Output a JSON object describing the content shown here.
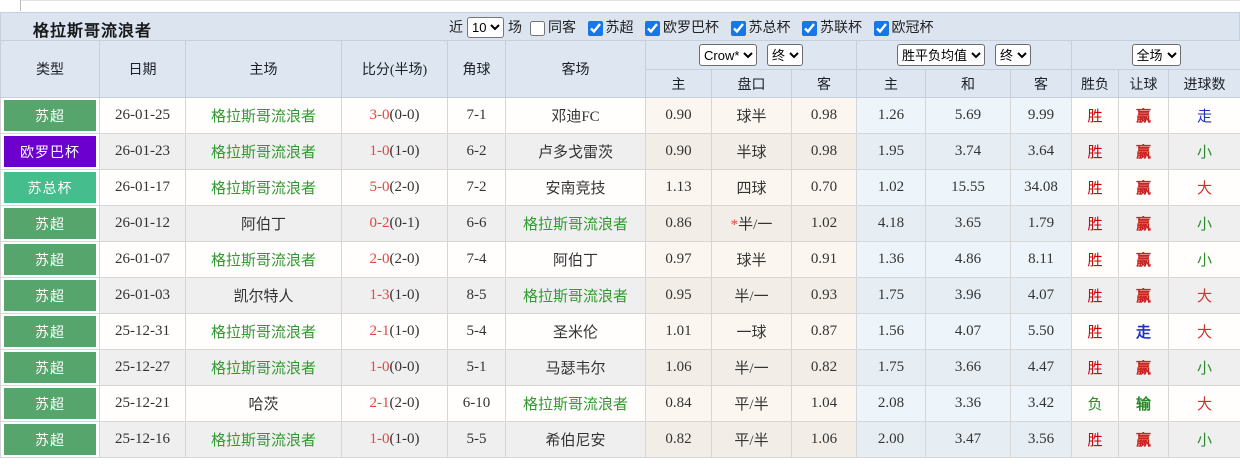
{
  "page": {
    "title_team": "格拉斯哥流浪者"
  },
  "header": {
    "near_label": "近",
    "near_value": "10",
    "games_label": "场",
    "filters": [
      {
        "label": "同客",
        "checked": false
      },
      {
        "label": "苏超",
        "checked": true
      },
      {
        "label": "欧罗巴杯",
        "checked": true
      },
      {
        "label": "苏总杯",
        "checked": true
      },
      {
        "label": "苏联杯",
        "checked": true
      },
      {
        "label": "欧冠杯",
        "checked": true
      }
    ]
  },
  "table": {
    "selects": {
      "bookmaker": "Crow*",
      "odds_state": "终",
      "avg": "胜平负均值",
      "avg_state": "终",
      "scope": "全场"
    },
    "columns": {
      "type": "类型",
      "date": "日期",
      "home": "主场",
      "score": "比分(半场)",
      "corner": "角球",
      "away": "客场",
      "odds_home": "主",
      "odds_handicap": "盘口",
      "odds_away": "客",
      "avg_home": "主",
      "avg_draw": "和",
      "avg_away": "客",
      "result": "胜负",
      "handicap": "让球",
      "goals": "进球数"
    },
    "rows": [
      {
        "type": "苏超",
        "date": "26-01-25",
        "home": "格拉斯哥流浪者",
        "score_ft": "3-0",
        "score_ht": "(0-0)",
        "corner": "7-1",
        "away": "邓迪FC",
        "crow": [
          "0.90",
          "球半",
          "0.98"
        ],
        "avg": [
          "1.26",
          "5.69",
          "9.99"
        ],
        "result": "胜",
        "handicap": "赢",
        "goals": "走"
      },
      {
        "type": "欧罗巴杯",
        "date": "26-01-23",
        "home": "格拉斯哥流浪者",
        "score_ft": "1-0",
        "score_ht": "(1-0)",
        "corner": "6-2",
        "away": "卢多戈雷茨",
        "crow": [
          "0.90",
          "半球",
          "0.98"
        ],
        "avg": [
          "1.95",
          "3.74",
          "3.64"
        ],
        "result": "胜",
        "handicap": "赢",
        "goals": "小"
      },
      {
        "type": "苏总杯",
        "date": "26-01-17",
        "home": "格拉斯哥流浪者",
        "score_ft": "5-0",
        "score_ht": "(2-0)",
        "corner": "7-2",
        "away": "安南竞技",
        "crow": [
          "1.13",
          "四球",
          "0.70"
        ],
        "avg": [
          "1.02",
          "15.55",
          "34.08"
        ],
        "result": "胜",
        "handicap": "赢",
        "goals": "大"
      },
      {
        "type": "苏超",
        "date": "26-01-12",
        "home": "阿伯丁",
        "score_ft": "0-2",
        "score_ht": "(0-1)",
        "corner": "6-6",
        "away": "格拉斯哥流浪者",
        "crow": [
          "0.86",
          "*半/一",
          "1.02"
        ],
        "avg": [
          "4.18",
          "3.65",
          "1.79"
        ],
        "result": "胜",
        "handicap": "赢",
        "goals": "小"
      },
      {
        "type": "苏超",
        "date": "26-01-07",
        "home": "格拉斯哥流浪者",
        "score_ft": "2-0",
        "score_ht": "(2-0)",
        "corner": "7-4",
        "away": "阿伯丁",
        "crow": [
          "0.97",
          "球半",
          "0.91"
        ],
        "avg": [
          "1.36",
          "4.86",
          "8.11"
        ],
        "result": "胜",
        "handicap": "赢",
        "goals": "小"
      },
      {
        "type": "苏超",
        "date": "26-01-03",
        "home": "凯尔特人",
        "score_ft": "1-3",
        "score_ht": "(1-0)",
        "corner": "8-5",
        "away": "格拉斯哥流浪者",
        "crow": [
          "0.95",
          "半/一",
          "0.93"
        ],
        "avg": [
          "1.75",
          "3.96",
          "4.07"
        ],
        "result": "胜",
        "handicap": "赢",
        "goals": "大"
      },
      {
        "type": "苏超",
        "date": "25-12-31",
        "home": "格拉斯哥流浪者",
        "score_ft": "2-1",
        "score_ht": "(1-0)",
        "corner": "5-4",
        "away": "圣米伦",
        "crow": [
          "1.01",
          "一球",
          "0.87"
        ],
        "avg": [
          "1.56",
          "4.07",
          "5.50"
        ],
        "result": "胜",
        "handicap": "走",
        "goals": "大"
      },
      {
        "type": "苏超",
        "date": "25-12-27",
        "home": "格拉斯哥流浪者",
        "score_ft": "1-0",
        "score_ht": "(0-0)",
        "corner": "5-1",
        "away": "马瑟韦尔",
        "crow": [
          "1.06",
          "半/一",
          "0.82"
        ],
        "avg": [
          "1.75",
          "3.66",
          "4.47"
        ],
        "result": "胜",
        "handicap": "赢",
        "goals": "小"
      },
      {
        "type": "苏超",
        "date": "25-12-21",
        "home": "哈茨",
        "score_ft": "2-1",
        "score_ht": "(2-0)",
        "corner": "6-10",
        "away": "格拉斯哥流浪者",
        "crow": [
          "0.84",
          "平/半",
          "1.04"
        ],
        "avg": [
          "2.08",
          "3.36",
          "3.42"
        ],
        "result": "负",
        "handicap": "输",
        "goals": "大"
      },
      {
        "type": "苏超",
        "date": "25-12-16",
        "home": "格拉斯哥流浪者",
        "score_ft": "1-0",
        "score_ht": "(1-0)",
        "corner": "5-5",
        "away": "希伯尼安",
        "crow": [
          "0.82",
          "平/半",
          "1.06"
        ],
        "avg": [
          "2.00",
          "3.47",
          "3.56"
        ],
        "result": "胜",
        "handicap": "赢",
        "goals": "小"
      }
    ]
  },
  "colors": {
    "type_badges": {
      "苏超": "#55a56c",
      "欧罗巴杯": "#6c00cf",
      "苏总杯": "#45bd8c"
    },
    "team_green": "#339933",
    "score_red": "#e9443d",
    "values": {
      "胜": "#cc0000",
      "负": "#2a8a2a",
      "赢": "#cc2222",
      "输": "#2a8a2a",
      "走": "#2233bb",
      "大": "#cc3333",
      "小": "#2e8b2e"
    }
  }
}
